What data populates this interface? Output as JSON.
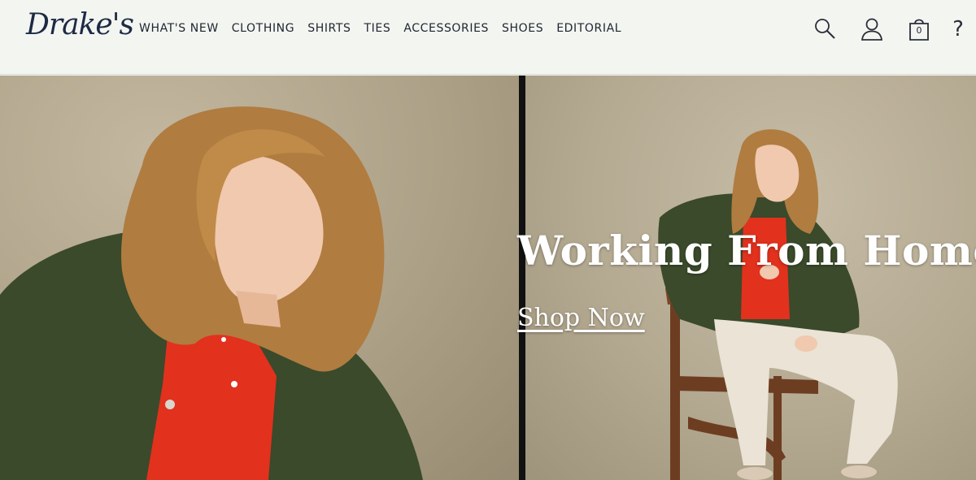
{
  "brand": {
    "logo_text": "Drake's"
  },
  "nav": {
    "items": [
      {
        "label": "WHAT'S NEW"
      },
      {
        "label": "CLOTHING"
      },
      {
        "label": "SHIRTS"
      },
      {
        "label": "TIES"
      },
      {
        "label": "ACCESSORIES"
      },
      {
        "label": "SHOES"
      },
      {
        "label": "EDITORIAL"
      }
    ]
  },
  "header_icons": {
    "search": "search-icon",
    "account": "user-icon",
    "cart": "shopping-bag-icon",
    "cart_count": "0",
    "help_glyph": "?"
  },
  "hero": {
    "title": "Working From Home",
    "cta": "Shop Now"
  },
  "colors": {
    "header_bg": "#f3f5f1",
    "text": "#1f2530",
    "logo": "#1d2a44",
    "jacket": "#3b4a2a",
    "shirt": "#e2311d"
  }
}
